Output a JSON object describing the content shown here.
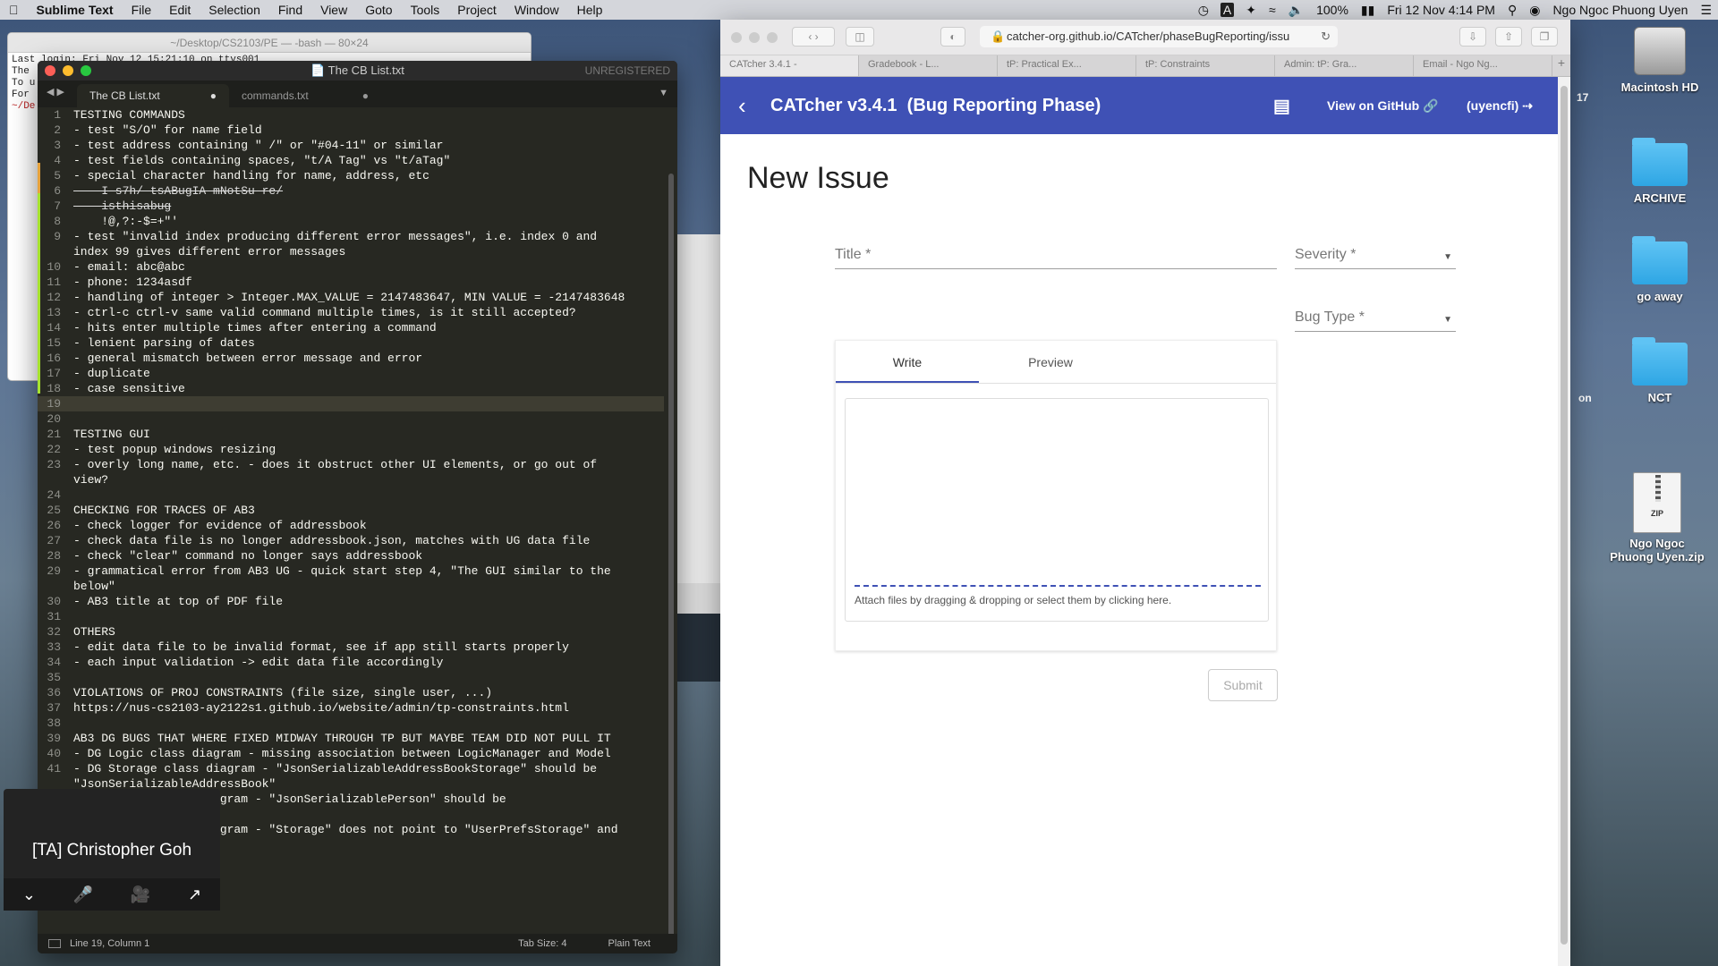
{
  "menubar": {
    "app": "Sublime Text",
    "items": [
      "File",
      "Edit",
      "Selection",
      "Find",
      "View",
      "Goto",
      "Tools",
      "Project",
      "Window",
      "Help"
    ],
    "battery": "100%",
    "datetime": "Fri 12 Nov  4:14 PM",
    "user": "Ngo Ngoc Phuong Uyen"
  },
  "desktop": {
    "hdd": "Macintosh HD",
    "folders": [
      "ARCHIVE",
      "go away",
      "NCT"
    ],
    "zip": "Ngo Ngoc Phuong Uyen.zip",
    "zip_badge": "ZIP",
    "edge_text_1": "17",
    "edge_text_2": "on"
  },
  "terminal": {
    "title": "~/Desktop/CS2103/PE — -bash — 80×24",
    "lines": [
      "Last login: Fri Nov 12 15:21:10 on ttys001",
      "The",
      "To u",
      "For",
      "~/De"
    ]
  },
  "sublime": {
    "title": "The CB List.txt",
    "unregistered": "UNREGISTERED",
    "tabs": [
      {
        "label": "The CB List.txt",
        "dot": "●"
      },
      {
        "label": "commands.txt",
        "dot": "●"
      }
    ],
    "nav": "◀ ▶",
    "tabmenu": "▼",
    "lines": [
      {
        "n": "1",
        "t": "TESTING COMMANDS"
      },
      {
        "n": "2",
        "t": "- test \"S/O\" for name field"
      },
      {
        "n": "3",
        "t": "- test address containing \" /\" or \"#04-11\" or similar"
      },
      {
        "n": "4",
        "t": "- test fields containing spaces, \"t/A Tag\" vs \"t/aTag\""
      },
      {
        "n": "5",
        "t": "- special character handling for name, address, etc"
      },
      {
        "n": "6",
        "t": "    I-s7h/ tsABugIA mNotSu-re/"
      },
      {
        "n": "7",
        "t": "    isthisabug"
      },
      {
        "n": "8",
        "t": "    !@,?:-$=+\"'"
      },
      {
        "n": "9",
        "t": "- test \"invalid index producing different error messages\", i.e. index 0 and"
      },
      {
        "n": "",
        "t": "index 99 gives different error messages"
      },
      {
        "n": "10",
        "t": "- email: abc@abc"
      },
      {
        "n": "11",
        "t": "- phone: 1234asdf"
      },
      {
        "n": "12",
        "t": "- handling of integer > Integer.MAX_VALUE = 2147483647, MIN VALUE = -2147483648"
      },
      {
        "n": "13",
        "t": "- ctrl-c ctrl-v same valid command multiple times, is it still accepted?"
      },
      {
        "n": "14",
        "t": "- hits enter multiple times after entering a command"
      },
      {
        "n": "15",
        "t": "- lenient parsing of dates"
      },
      {
        "n": "16",
        "t": "- general mismatch between error message and error"
      },
      {
        "n": "17",
        "t": "- duplicate"
      },
      {
        "n": "18",
        "t": "- case sensitive"
      },
      {
        "n": "19",
        "t": ""
      },
      {
        "n": "20",
        "t": ""
      },
      {
        "n": "21",
        "t": "TESTING GUI"
      },
      {
        "n": "22",
        "t": "- test popup windows resizing"
      },
      {
        "n": "23",
        "t": "- overly long name, etc. - does it obstruct other UI elements, or go out of"
      },
      {
        "n": "",
        "t": "view?"
      },
      {
        "n": "24",
        "t": ""
      },
      {
        "n": "25",
        "t": "CHECKING FOR TRACES OF AB3"
      },
      {
        "n": "26",
        "t": "- check logger for evidence of addressbook"
      },
      {
        "n": "27",
        "t": "- check data file is no longer addressbook.json, matches with UG data file"
      },
      {
        "n": "28",
        "t": "- check \"clear\" command no longer says addressbook"
      },
      {
        "n": "29",
        "t": "- grammatical error from AB3 UG - quick start step 4, \"The GUI similar to the"
      },
      {
        "n": "",
        "t": "below\""
      },
      {
        "n": "30",
        "t": "- AB3 title at top of PDF file"
      },
      {
        "n": "31",
        "t": ""
      },
      {
        "n": "32",
        "t": "OTHERS"
      },
      {
        "n": "33",
        "t": "- edit data file to be invalid format, see if app still starts properly"
      },
      {
        "n": "34",
        "t": "- each input validation -> edit data file accordingly"
      },
      {
        "n": "35",
        "t": ""
      },
      {
        "n": "36",
        "t": "VIOLATIONS OF PROJ CONSTRAINTS (file size, single user, ...)"
      },
      {
        "n": "37",
        "t": "https://nus-cs2103-ay2122s1.github.io/website/admin/tp-constraints.html"
      },
      {
        "n": "38",
        "t": ""
      },
      {
        "n": "39",
        "t": "AB3 DG BUGS THAT WHERE FIXED MIDWAY THROUGH TP BUT MAYBE TEAM DID NOT PULL IT"
      },
      {
        "n": "40",
        "t": "- DG Logic class diagram - missing association between LogicManager and Model"
      },
      {
        "n": "41",
        "t": "- DG Storage class diagram - \"JsonSerializableAddressBookStorage\" should be"
      },
      {
        "n": "",
        "t": "\"JsonSerializableAddressBook\""
      },
      {
        "n": "",
        "t": "                  diagram - \"JsonSerializablePerson\" should be"
      },
      {
        "n": "",
        "t": "                  \""
      },
      {
        "n": "",
        "t": "                  diagram - \"Storage\" does not point to \"UserPrefsStorage\" and"
      },
      {
        "n": "",
        "t": "                  e\""
      }
    ],
    "status": {
      "position": "Line 19, Column 1",
      "tabsize": "Tab Size: 4",
      "syntax": "Plain Text"
    }
  },
  "zoom": {
    "participant": "[TA] Christopher Goh",
    "icons": [
      "chevron-down-icon",
      "mic-muted-icon",
      "video-icon",
      "share-icon"
    ]
  },
  "safari": {
    "url": "catcher-org.github.io/CATcher/phaseBugReporting/issu",
    "tabs": [
      "CATcher 3.4.1 -",
      "Gradebook - L...",
      "tP: Practical Ex...",
      "tP: Constraints",
      "Admin: tP: Gra...",
      "Email - Ngo Ng..."
    ],
    "app": {
      "title": "CATcher v3.4.1  (Bug Reporting Phase)",
      "github": "View on GitHub",
      "user": "(uyencfi)"
    },
    "page": {
      "heading": "New Issue",
      "title_label": "Title *",
      "severity_label": "Severity *",
      "bugtype_label": "Bug Type *",
      "write_tab": "Write",
      "preview_tab": "Preview",
      "attach_text": "Attach files by dragging & dropping or select them by clicking here.",
      "submit": "Submit"
    }
  },
  "colors": {
    "appbar": "#3f51b5",
    "editor_bg": "#272822",
    "folder": "#3aa9e6"
  }
}
